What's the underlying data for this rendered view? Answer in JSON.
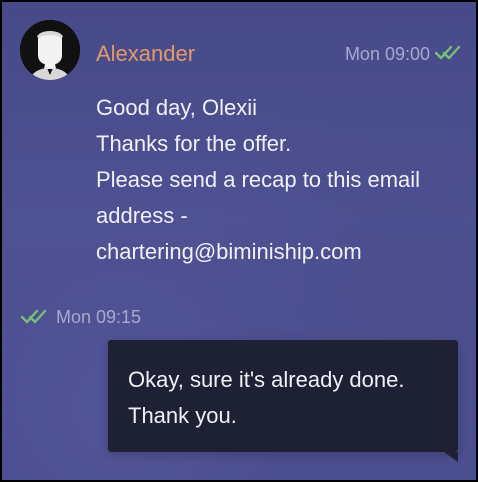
{
  "conversation": {
    "incoming": {
      "sender": "Alexander",
      "time": "Mon 09:00",
      "status_icon": "double-check-icon",
      "avatar_icon": "user-avatar-icon",
      "lines": [
        "Good day, Olexii",
        "Thanks for the offer.",
        "Please send a recap to this email",
        "address -",
        "chartering@biminiship.com"
      ]
    },
    "outgoing": {
      "time": "Mon 09:15",
      "status_icon": "double-check-icon",
      "lines": [
        "Okay, sure it's already done.",
        "Thank you."
      ]
    }
  },
  "colors": {
    "background": "#4b4e8f",
    "sender_name": "#e29a6a",
    "timestamp": "#a8aacd",
    "check": "#79bf73",
    "message_text": "#f0f0f7",
    "outgoing_bubble": "#1e2033"
  }
}
